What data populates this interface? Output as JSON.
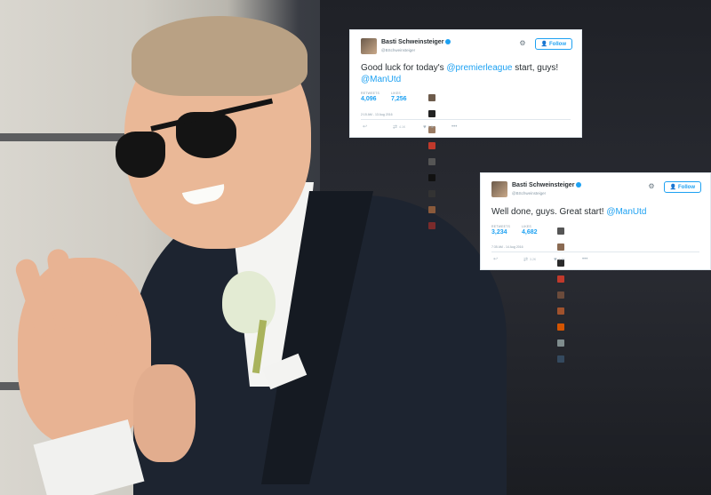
{
  "tweets": [
    {
      "name": "Basti Schweinsteiger",
      "handle": "@BSchweinsteiger",
      "follow_label": "Follow",
      "text_parts": {
        "t1": "Good luck for today's ",
        "m1": "@premierleague",
        "t2": " start, guys! ",
        "m2": "@ManUtd"
      },
      "stats": {
        "retweets_label": "RETWEETS",
        "retweets": "4,096",
        "likes_label": "LIKES",
        "likes": "7,256"
      },
      "timestamp": "2:15 AM - 13 Aug 2016",
      "action_counts": {
        "retweets": "4.1K",
        "likes": "7.3K"
      }
    },
    {
      "name": "Basti Schweinsteiger",
      "handle": "@BSchweinsteiger",
      "follow_label": "Follow",
      "text_parts": {
        "t1": "Well done, guys. Great start! ",
        "m1": "@ManUtd"
      },
      "stats": {
        "retweets_label": "RETWEETS",
        "retweets": "3,234",
        "likes_label": "LIKES",
        "likes": "4,682"
      },
      "timestamp": "7:35 AM - 14 Aug 2016",
      "action_counts": {
        "retweets": "3.2K",
        "likes": "4.7K"
      }
    }
  ],
  "colors": {
    "accent": "#1da1f2",
    "text": "#292f33",
    "muted": "#8899a6"
  },
  "icons": [
    "verified-badge-icon",
    "gear-icon",
    "follow-person-icon",
    "reply-icon",
    "retweet-icon",
    "like-heart-icon",
    "more-icon"
  ]
}
